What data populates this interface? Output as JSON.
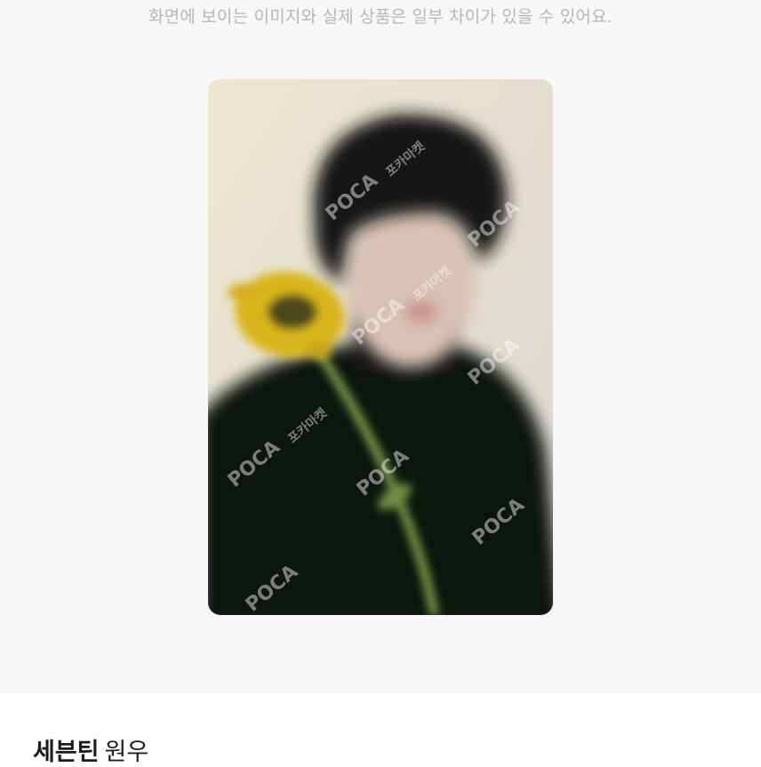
{
  "gallery": {
    "disclaimer": "화면에 보이는 이미지와 실제 상품은 일부 차이가 있을 수 있어요.",
    "photocard": {
      "watermark_brand": "POCA",
      "watermark_sub": "포카마켓",
      "colors": {
        "background": "#e8e3d0",
        "outfit": "#101311",
        "hair": "#121212",
        "skin": "#d9c2b4",
        "sunflower_petals": "#d9b51e",
        "sunflower_center": "#4b4a1f",
        "stem": "#7a9a4a"
      }
    }
  },
  "product": {
    "group": "세븐틴",
    "member": "원우"
  }
}
